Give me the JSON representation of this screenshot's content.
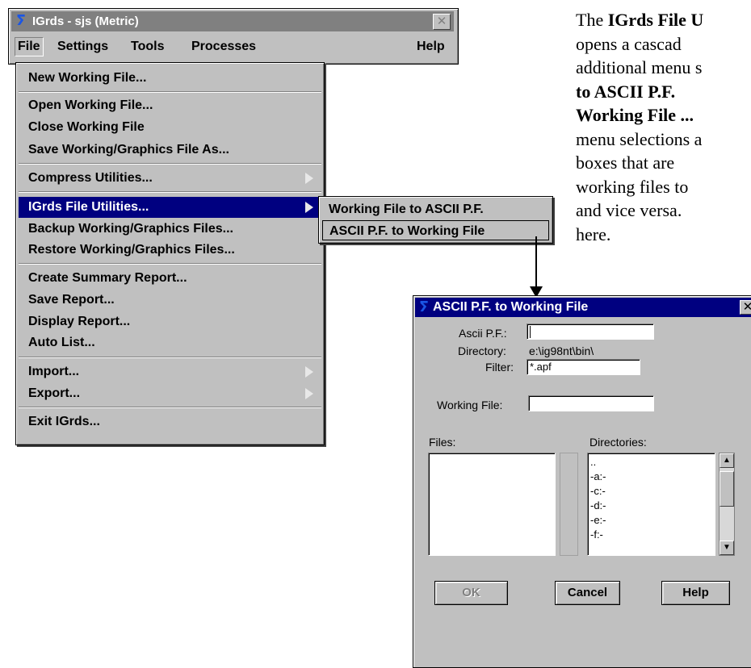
{
  "main_window": {
    "title": "IGrds - sjs (Metric)",
    "icon": "igrds-logo-icon",
    "close_icon": "close-icon",
    "menubar": {
      "file": "File",
      "settings": "Settings",
      "tools": "Tools",
      "processes": "Processes",
      "help": "Help"
    }
  },
  "file_menu": {
    "items": [
      {
        "label": "New Working File..."
      },
      {
        "label": "Open Working File..."
      },
      {
        "label": "Close Working File"
      },
      {
        "label": "Save Working/Graphics File As..."
      },
      {
        "label": "Compress Utilities...",
        "submenu": true
      },
      {
        "label": "IGrds File Utilities...",
        "submenu": true,
        "highlighted": true
      },
      {
        "label": "Backup Working/Graphics Files..."
      },
      {
        "label": "Restore Working/Graphics Files..."
      },
      {
        "label": "Create Summary Report..."
      },
      {
        "label": "Save Report..."
      },
      {
        "label": "Display Report..."
      },
      {
        "label": "Auto List..."
      },
      {
        "label": "Import...",
        "submenu": true
      },
      {
        "label": "Export...",
        "submenu": true
      },
      {
        "label": "Exit IGrds..."
      }
    ]
  },
  "submenu": {
    "items": [
      {
        "label": "Working File to ASCII P.F."
      },
      {
        "label": "ASCII P.F. to Working File"
      }
    ]
  },
  "paragraph": {
    "lines": [
      [
        "The ",
        "IGrds File U"
      ],
      [
        "opens   a   cascad"
      ],
      [
        "additional menu s"
      ],
      [
        "",
        "to ASCII P.F. "
      ],
      [
        "",
        "Working File ..."
      ],
      [
        "menu selections a"
      ],
      [
        "boxes  that  are  "
      ],
      [
        "working files to "
      ],
      [
        "and vice versa.  "
      ],
      [
        "here."
      ]
    ]
  },
  "dialog": {
    "title": "ASCII P.F. to Working File",
    "ascii_pf_label": "Ascii P.F.:",
    "ascii_pf_value": "",
    "directory_label": "Directory:",
    "directory_value": "e:\\ig98nt\\bin\\",
    "filter_label": "Filter:",
    "filter_value": "*.apf",
    "working_file_label": "Working File:",
    "working_file_value": "",
    "files_label": "Files:",
    "directories_label": "Directories:",
    "directories": [
      "..",
      "-a:-",
      "-c:-",
      "-d:-",
      "-e:-",
      "-f:-"
    ],
    "ok_button": "OK",
    "cancel_button": "Cancel",
    "help_button": "Help"
  }
}
